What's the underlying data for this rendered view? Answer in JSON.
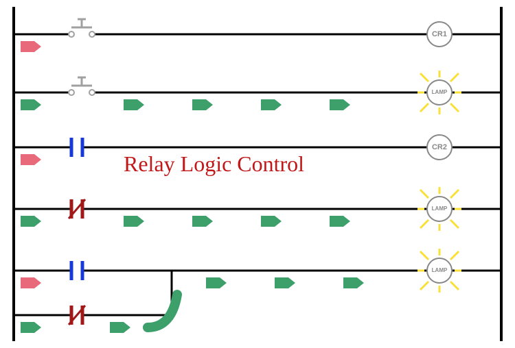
{
  "title": "Relay Logic Control",
  "rungs": {
    "r1": {
      "output_label": "CR1"
    },
    "r2": {
      "output_label": "LAMP"
    },
    "r3": {
      "output_label": "CR2"
    },
    "r4": {
      "output_label": "LAMP"
    },
    "r5": {
      "output_label": "LAMP"
    }
  },
  "colors": {
    "wire": "#000000",
    "pushbutton": "#a0a0a0",
    "contact_no": "#1838d8",
    "contact_nc": "#a01818",
    "arrow_on": "#3da06a",
    "arrow_off": "#e86a7a",
    "lamp_ray": "#f8e038",
    "coil_stroke": "#888888",
    "title": "#c01818"
  }
}
